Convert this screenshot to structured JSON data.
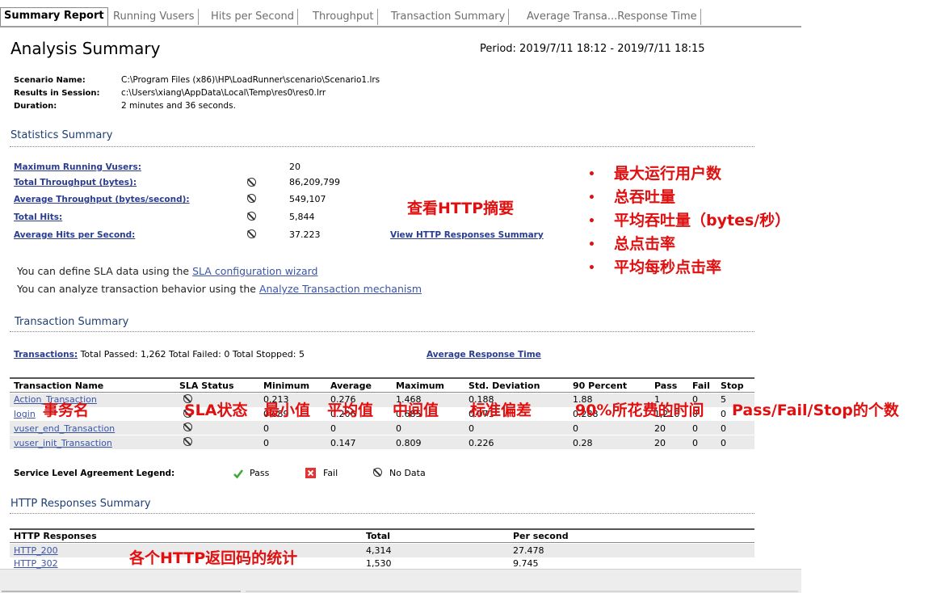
{
  "tabs": [
    "Summary Report",
    "Running Vusers",
    "Hits per Second",
    "Throughput",
    "Transaction Summary",
    "Average Transa...Response Time"
  ],
  "header": {
    "title": "Analysis Summary",
    "period": "Period: 2019/7/11 18:12 - 2019/7/11 18:15"
  },
  "meta": [
    {
      "label": "Scenario Name:",
      "value": "C:\\Program Files (x86)\\HP\\LoadRunner\\scenario\\Scenario1.lrs"
    },
    {
      "label": "Results in Session:",
      "value": "c:\\Users\\xiang\\AppData\\Local\\Temp\\res0\\res0.lrr"
    },
    {
      "label": "Duration:",
      "value": "2 minutes and 36 seconds."
    }
  ],
  "stats": {
    "heading": "Statistics Summary",
    "rows": [
      {
        "label": "Maximum Running Vusers:",
        "value": "20"
      },
      {
        "label": "Total Throughput (bytes):",
        "value": "86,209,799"
      },
      {
        "label": "Average Throughput (bytes/second):",
        "value": "549,107"
      },
      {
        "label": "Total Hits:",
        "value": "5,844"
      },
      {
        "label": "Average Hits per Second:",
        "value": "37.223"
      }
    ],
    "http_link": "View HTTP Responses Summary",
    "sla_prefix": "You can define SLA data using the ",
    "sla_link": "SLA configuration wizard",
    "analyze_prefix": "You can analyze transaction behavior using the ",
    "analyze_link": "Analyze Transaction mechanism"
  },
  "transactions": {
    "heading": "Transaction Summary",
    "link_label": "Transactions:",
    "totals": "Total Passed: 1,262 Total Failed: 0 Total Stopped: 5",
    "avg_link": "Average Response Time",
    "columns": [
      "Transaction Name",
      "SLA Status",
      "Minimum",
      "Average",
      "Maximum",
      "Std. Deviation",
      "90 Percent",
      "Pass",
      "Fail",
      "Stop"
    ],
    "rows": [
      [
        "Action_Transaction",
        "",
        "0.213",
        "0.276",
        "1.468",
        "0.188",
        "1.88",
        "1",
        "0",
        "5"
      ],
      [
        "login",
        "",
        "0.089",
        "0.206",
        "0.685",
        "0.071",
        "0.288",
        "1,210",
        "0",
        "0"
      ],
      [
        "vuser_end_Transaction",
        "",
        "0",
        "0",
        "0",
        "0",
        "0",
        "20",
        "0",
        "0"
      ],
      [
        "vuser_init_Transaction",
        "",
        "0",
        "0.147",
        "0.809",
        "0.226",
        "0.28",
        "20",
        "0",
        "0"
      ]
    ],
    "legend_label": "Service Level Agreement Legend:",
    "legend": [
      "Pass",
      "Fail",
      "No Data"
    ]
  },
  "http": {
    "heading": "HTTP Responses Summary",
    "columns": [
      "HTTP Responses",
      "Total",
      "Per second"
    ],
    "rows": [
      [
        "HTTP_200",
        "4,314",
        "27.478"
      ],
      [
        "HTTP_302",
        "1,530",
        "9.745"
      ]
    ]
  },
  "annotations": {
    "http_summary": "查看HTTP摘要",
    "bullets": [
      "最大运行用户数",
      "总吞吐量",
      "平均吞吐量（bytes/秒）",
      "总点击率",
      "平均每秒点击率"
    ],
    "txn_name": "事务名",
    "sla": "SLA状态",
    "min": "最小值",
    "avg": "平均值",
    "mid": "中间值",
    "std": "标准偏差",
    "p90": "90%所花费的时间",
    "pfs": "Pass/Fail/Stop的个数",
    "http_codes": "各个HTTP返回码的统计"
  },
  "colors": {
    "accent": "#1d3f73",
    "link": "#3a55a8",
    "annotation": "#e01010"
  }
}
